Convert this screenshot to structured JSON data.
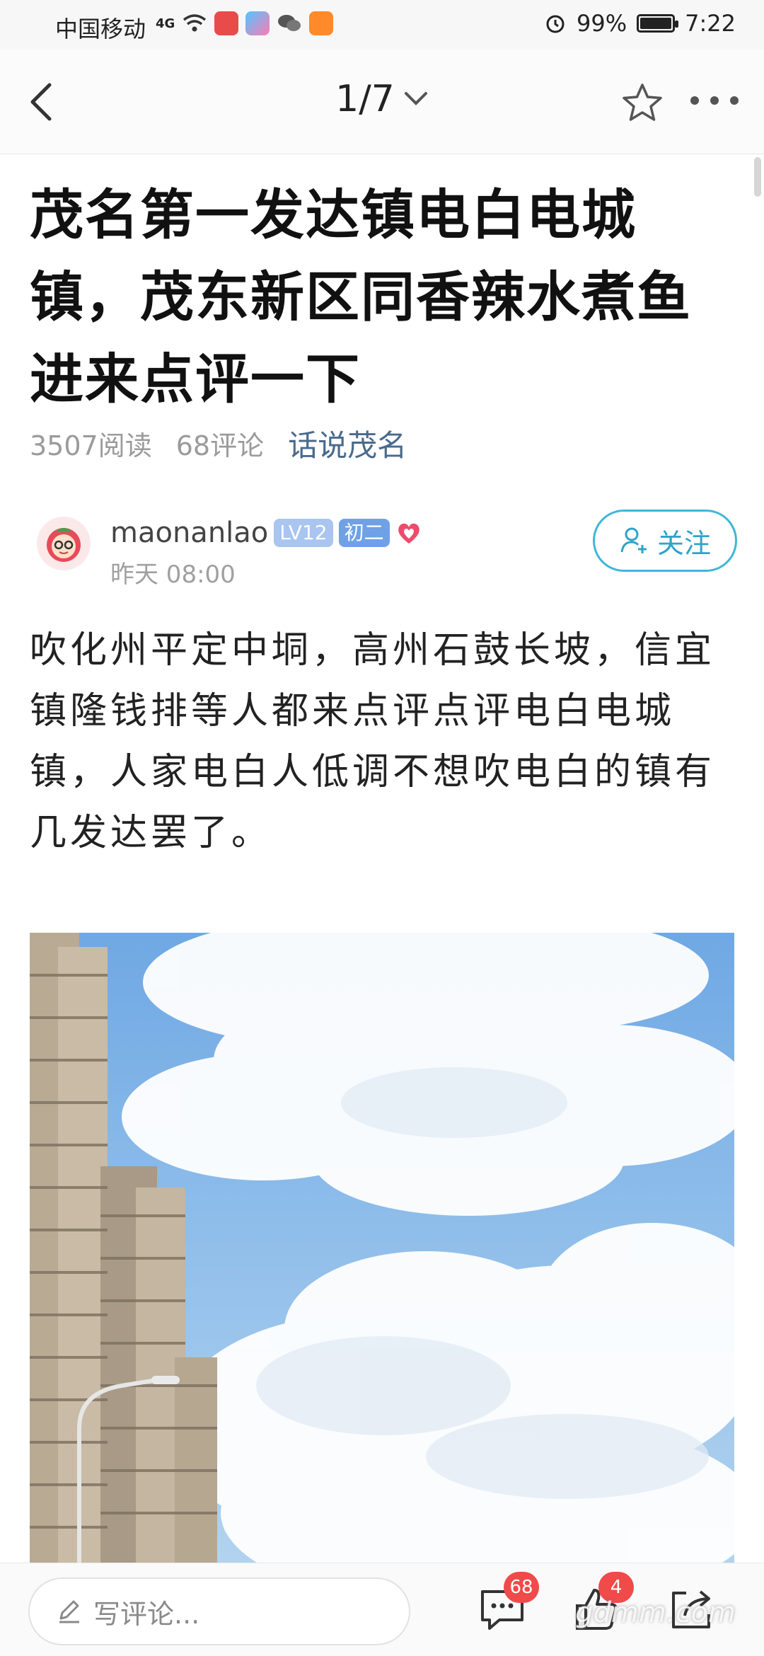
{
  "status_bar": {
    "carrier": "中国移动",
    "network": "4G",
    "battery": "99%",
    "battery_level": 0.99,
    "time": "7:22"
  },
  "nav": {
    "counter": "1/7",
    "icons": [
      "back-arrow-icon",
      "chevron-down-icon",
      "star-icon",
      "more-icon"
    ]
  },
  "article": {
    "title": "茂名第一发达镇电白电城镇，茂东新区同香辣水煮鱼进来点评一下",
    "reads": "3507阅读",
    "comments": "68评论",
    "topic": "话说茂名",
    "author": {
      "name": "maonanlao",
      "level": "LV12",
      "grade": "初二",
      "time": "昨天 08:00"
    },
    "follow_label": "关注",
    "body": "吹化州平定中垌，高州石鼓长坡，信宜镇隆钱排等人都来点评点评电白电城镇，人家电白人低调不想吹电白的镇有几发达罢了。"
  },
  "bottom_bar": {
    "comment_placeholder": "写评论...",
    "comment_count": "68",
    "like_count": "4"
  },
  "watermark": "gdmm.com",
  "colors": {
    "accent": "#2ea4c9",
    "topic": "#4a6a8c",
    "badge_red": "#f04a4a"
  }
}
